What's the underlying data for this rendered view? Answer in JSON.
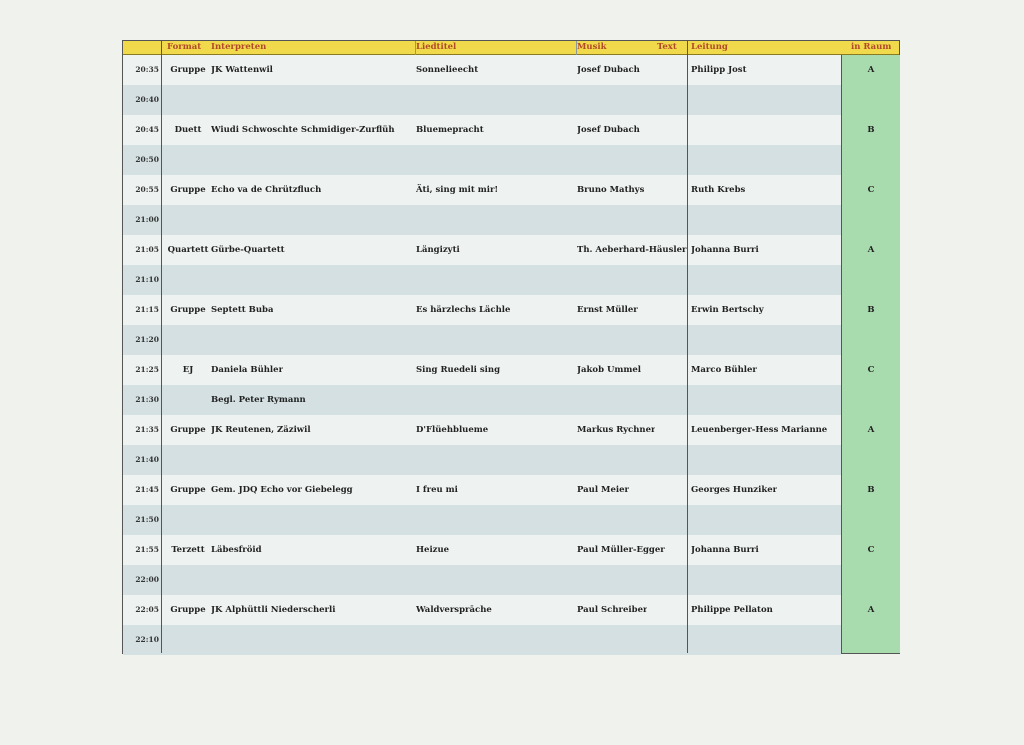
{
  "header": {
    "format": "Format",
    "interpreten": "Interpreten",
    "liedtitel": "Liedtitel",
    "musik": "Musik",
    "text": "Text",
    "leitung": "Leitung",
    "raum": "in Raum"
  },
  "rows": [
    {
      "time": "20:35",
      "format": "Gruppe",
      "interpreten": "JK Wattenwil",
      "lied": "Sonnelieecht",
      "musik": "Josef Dubach",
      "leitung": "Philipp Jost",
      "raum": "A"
    },
    {
      "time": "20:40",
      "format": "",
      "interpreten": "",
      "lied": "",
      "musik": "",
      "leitung": "",
      "raum": ""
    },
    {
      "time": "20:45",
      "format": "Duett",
      "interpreten": "Wiudi Schwoschte Schmidiger-Zurflüh",
      "lied": "Bluemepracht",
      "musik": "Josef Dubach",
      "leitung": "",
      "raum": "B"
    },
    {
      "time": "20:50",
      "format": "",
      "interpreten": "",
      "lied": "",
      "musik": "",
      "leitung": "",
      "raum": ""
    },
    {
      "time": "20:55",
      "format": "Gruppe",
      "interpreten": "Echo va de Chrützfluch",
      "lied": "Äti, sing mit mir!",
      "musik": "Bruno Mathys",
      "leitung": "Ruth Krebs",
      "raum": "C"
    },
    {
      "time": "21:00",
      "format": "",
      "interpreten": "",
      "lied": "",
      "musik": "",
      "leitung": "",
      "raum": ""
    },
    {
      "time": "21:05",
      "format": "Quartett",
      "interpreten": "Gürbe-Quartett",
      "lied": "Längizyti",
      "musik": "Th. Aeberhard-Häusler",
      "leitung": "Johanna Burri",
      "raum": "A"
    },
    {
      "time": "21:10",
      "format": "",
      "interpreten": "",
      "lied": "",
      "musik": "",
      "leitung": "",
      "raum": ""
    },
    {
      "time": "21:15",
      "format": "Gruppe",
      "interpreten": "Septett Buba",
      "lied": "Es härzlechs Lächle",
      "musik": "Ernst Müller",
      "leitung": "Erwin Bertschy",
      "raum": "B"
    },
    {
      "time": "21:20",
      "format": "",
      "interpreten": "",
      "lied": "",
      "musik": "",
      "leitung": "",
      "raum": ""
    },
    {
      "time": "21:25",
      "format": "EJ",
      "interpreten": "Daniela Bühler",
      "lied": "Sing Ruedeli sing",
      "musik": "Jakob Ummel",
      "leitung": "Marco Bühler",
      "raum": "C"
    },
    {
      "time": "21:30",
      "format": "",
      "interpreten": "Begl. Peter Rymann",
      "lied": "",
      "musik": "",
      "leitung": "",
      "raum": ""
    },
    {
      "time": "21:35",
      "format": "Gruppe",
      "interpreten": "JK Reutenen, Zäziwil",
      "lied": "D'Flüehblueme",
      "musik": "Markus Rychner",
      "leitung": "Leuenberger-Hess Marianne",
      "raum": "A"
    },
    {
      "time": "21:40",
      "format": "",
      "interpreten": "",
      "lied": "",
      "musik": "",
      "leitung": "",
      "raum": ""
    },
    {
      "time": "21:45",
      "format": "Gruppe",
      "interpreten": "Gem. JDQ Echo vor Giebelegg",
      "lied": "I freu mi",
      "musik": "Paul Meier",
      "leitung": "Georges Hunziker",
      "raum": "B"
    },
    {
      "time": "21:50",
      "format": "",
      "interpreten": "",
      "lied": "",
      "musik": "",
      "leitung": "",
      "raum": ""
    },
    {
      "time": "21:55",
      "format": "Terzett",
      "interpreten": "Läbesfröid",
      "lied": "Heizue",
      "musik": "Paul Müller-Egger",
      "leitung": "Johanna Burri",
      "raum": "C"
    },
    {
      "time": "22:00",
      "format": "",
      "interpreten": "",
      "lied": "",
      "musik": "",
      "leitung": "",
      "raum": ""
    },
    {
      "time": "22:05",
      "format": "Gruppe",
      "interpreten": "JK Alphüttli Niederscherli",
      "lied": "Waldversprāche",
      "musik": "Paul Schreiber",
      "leitung": "Philippe Pellaton",
      "raum": "A"
    },
    {
      "time": "22:10",
      "format": "",
      "interpreten": "",
      "lied": "",
      "musik": "",
      "leitung": "",
      "raum": ""
    }
  ]
}
